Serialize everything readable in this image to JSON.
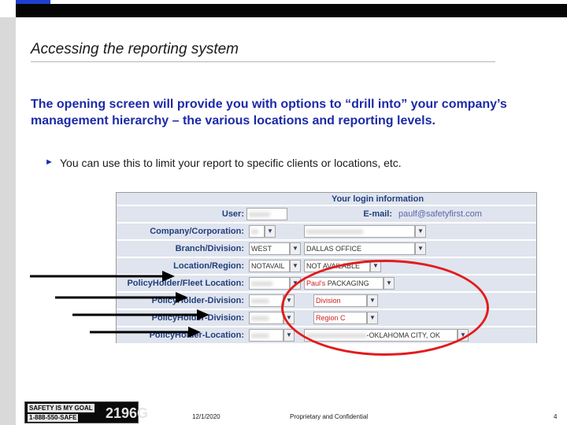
{
  "slide": {
    "title": "Accessing the reporting system",
    "lead": "The opening screen will provide you with options to “drill into” your company’s management hierarchy – the various locations and reporting levels.",
    "bullet": "You can use this to limit your report to specific clients or locations, etc.",
    "bullet_marker": "►"
  },
  "login_panel": {
    "header": "Your login information",
    "user_label": "User:",
    "email_label": "E-mail:",
    "email_value": "paulf@safetyfirst.com",
    "rows": [
      {
        "label": "Company/Corporation:",
        "value1": ""
      },
      {
        "label": "Branch/Division:",
        "value1": "WEST",
        "value2": "DALLAS OFFICE"
      },
      {
        "label": "Location/Region:",
        "value1": "NOTAVAIL",
        "value2": "NOT AVAILABLE"
      },
      {
        "label": "PolicyHolder/Fleet Location:",
        "value1": "",
        "value2a": "Paul's",
        "value2b": "PACKAGING"
      },
      {
        "label": "PolicyHolder-Division:",
        "value1": "",
        "value2": "Division"
      },
      {
        "label": "PolicyHolder-Division:",
        "value1": "",
        "value2": "Region C"
      },
      {
        "label": "PolicyHolder-Location:",
        "value1": "",
        "value2": "-OKLAHOMA CITY, OK"
      }
    ],
    "dropdown_glyph": "▼"
  },
  "footer": {
    "date": "12/1/2020",
    "confidential": "Proprietary and Confidential",
    "page": "4"
  },
  "logo": {
    "line1": "SAFETY IS MY GOAL",
    "line2": "1-888-550-SAFE",
    "big": "2196G"
  },
  "colors": {
    "title_blue": "#1c2aa8",
    "highlight_red": "#e21c1c",
    "panel_label_blue": "#223f7d",
    "panel_bg": "#dfe4ee"
  }
}
